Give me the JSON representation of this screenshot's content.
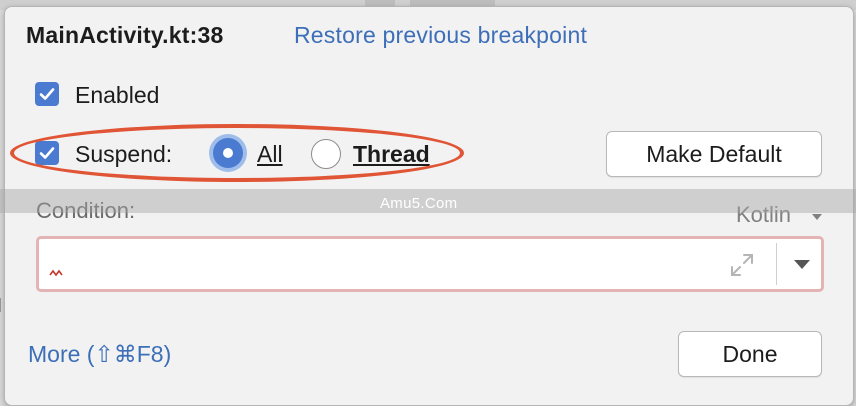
{
  "header": {
    "title": "MainActivity.kt:38",
    "restore_link": "Restore previous breakpoint"
  },
  "options": {
    "enabled_label": "Enabled",
    "enabled_checked": true,
    "suspend_label": "Suspend:",
    "suspend_checked": true,
    "suspend_all_label": "All",
    "suspend_thread_label": "Thread",
    "suspend_selected": "All"
  },
  "buttons": {
    "make_default": "Make Default",
    "done": "Done"
  },
  "condition": {
    "label": "Condition:",
    "language": "Kotlin",
    "value": ""
  },
  "footer": {
    "more_link": "More (⇧⌘F8)"
  },
  "watermark": "Amu5.Com",
  "colors": {
    "accent": "#4a7bd0",
    "link": "#3d6fb8",
    "highlight_oval": "#e05535",
    "invalid_border": "#e4b3b3"
  },
  "icons": [
    "checkbox-checked-icon",
    "radio-selected-icon",
    "radio-unselected-icon",
    "expand-icon",
    "dropdown-arrow-icon",
    "error-squiggle-icon"
  ]
}
